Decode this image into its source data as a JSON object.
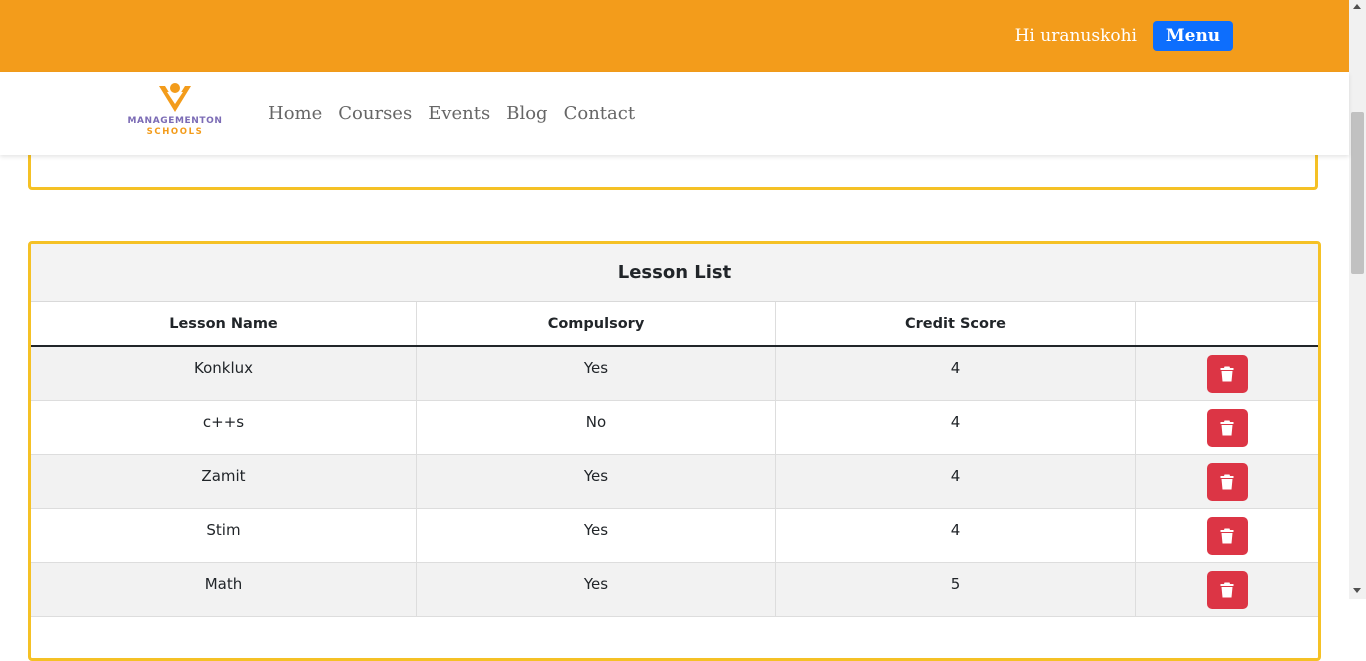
{
  "header": {
    "greeting": "Hi uranuskohi",
    "menu_label": "Menu"
  },
  "brand": {
    "line1": "MANAGEMENTON",
    "line2": "SCHOOLS",
    "colors": {
      "orange": "#f39c1b",
      "purple": "#7b6bb5"
    }
  },
  "nav": {
    "links": [
      "Home",
      "Courses",
      "Events",
      "Blog",
      "Contact"
    ]
  },
  "lesson_list": {
    "title": "Lesson List",
    "columns": [
      "Lesson Name",
      "Compulsory",
      "Credit Score",
      ""
    ],
    "rows": [
      {
        "name": "Konklux",
        "compulsory": "Yes",
        "credit": "4"
      },
      {
        "name": "c++s",
        "compulsory": "No",
        "credit": "4"
      },
      {
        "name": "Zamit",
        "compulsory": "Yes",
        "credit": "4"
      },
      {
        "name": "Stim",
        "compulsory": "Yes",
        "credit": "4"
      },
      {
        "name": "Math",
        "compulsory": "Yes",
        "credit": "5"
      }
    ],
    "delete_icon": "trash-icon"
  },
  "colors": {
    "topbar": "#f39c1b",
    "menu_button": "#0d6efd",
    "card_border": "#f5c125",
    "delete_button": "#dc3545"
  }
}
